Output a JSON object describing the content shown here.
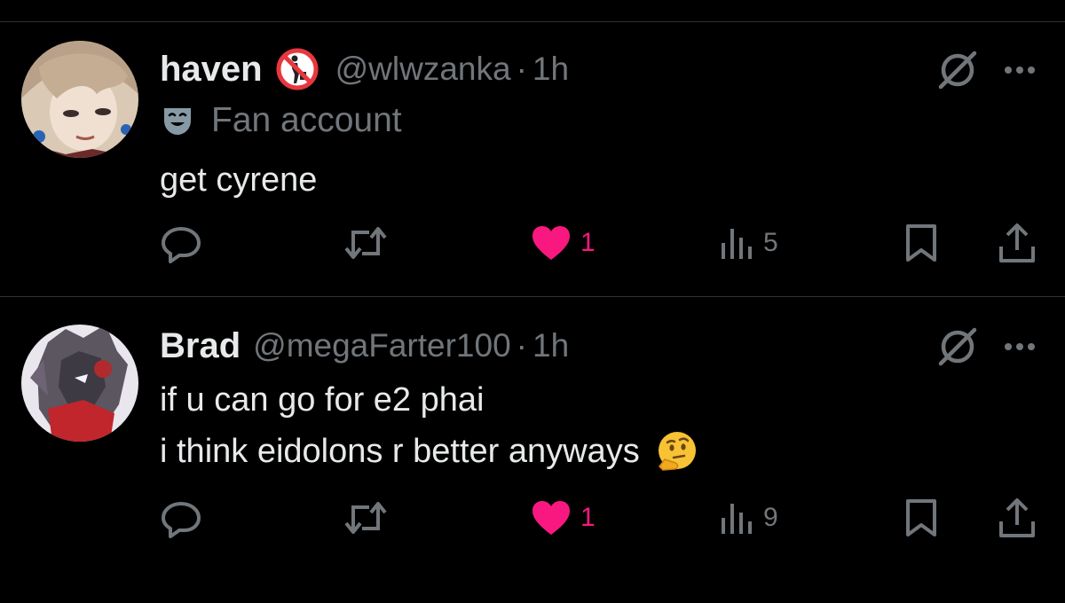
{
  "colors": {
    "background": "#000000",
    "text_primary": "#e7e9ea",
    "text_secondary": "#71767b",
    "like_active": "#f91880",
    "divider": "#2f3336"
  },
  "tweets": [
    {
      "display_name": "haven",
      "badge_icon": "no-littering-emoji",
      "handle": "@wlwzanka",
      "separator": "·",
      "time": "1h",
      "label_icon": "theater-mask-icon",
      "label": "Fan account",
      "text_lines": [
        "get cyrene"
      ],
      "likes": "1",
      "liked": true,
      "views": "5"
    },
    {
      "display_name": "Brad",
      "handle": "@megaFarter100",
      "separator": "·",
      "time": "1h",
      "text_lines": [
        "if u can go for e2 phai",
        "i think eidolons r better anyways"
      ],
      "text_emoji": "thinking-face-emoji",
      "likes": "1",
      "liked": true,
      "views": "9"
    }
  ]
}
